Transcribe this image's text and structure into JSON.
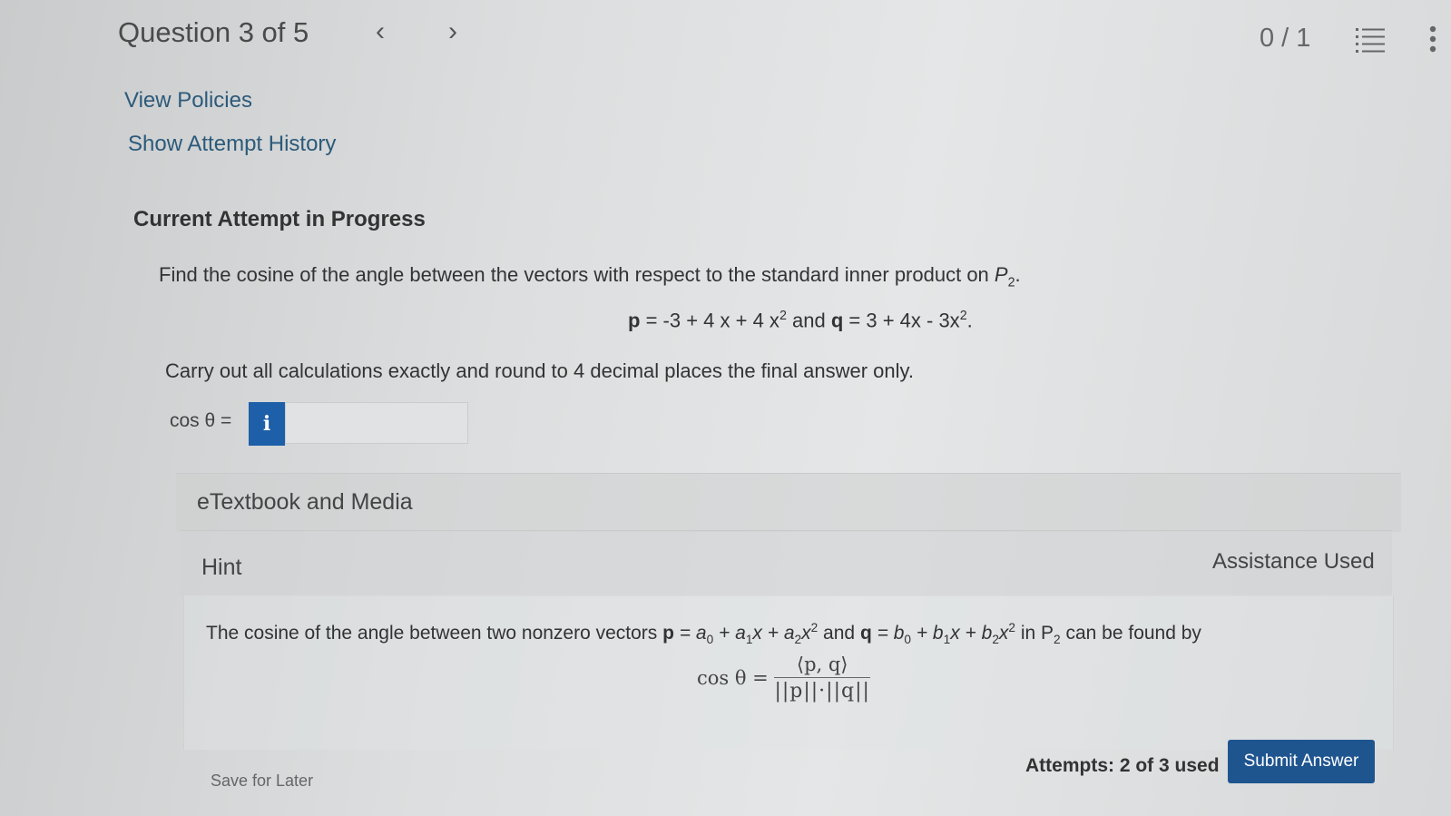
{
  "header": {
    "question_label": "Question 3 of 5",
    "prev_symbol": "‹",
    "next_symbol": "›",
    "score": "0 / 1"
  },
  "links": {
    "view_policies": "View Policies",
    "show_history": "Show Attempt History"
  },
  "attempt": {
    "section_title": "Current Attempt in Progress"
  },
  "question": {
    "prompt_prefix": "Find the cosine of the angle between the vectors with respect to the standard inner product on ",
    "space_symbol": "P",
    "space_sub": "2",
    "p_label": "p",
    "p_expr_a": " = -3 + 4 x + 4 x",
    "p_exp": "2",
    "and_word": " and ",
    "q_label": "q",
    "q_expr_a": " = 3 + 4x - 3x",
    "q_exp": "2",
    "end_period": ".",
    "instruction": "Carry out all calculations exactly and round to 4 decimal places the final answer only."
  },
  "answer": {
    "label": "cos θ =",
    "info_glyph": "i",
    "value": ""
  },
  "accordion": {
    "etextbook": "eTextbook and Media",
    "hint": "Hint",
    "assistance": "Assistance Used"
  },
  "hint": {
    "text_a": "The cosine of the angle between two nonzero vectors ",
    "p": "p",
    "p_eq": " = a",
    "s0": "0",
    "plus_a1": " + a",
    "s1": "1",
    "x_plus_a2": "x + a",
    "s2": "2",
    "x": "x",
    "sup2": "2",
    "and_q": " and ",
    "q": "q",
    "q_eq": " = b",
    "t0": "0",
    "plus_b1": " + b",
    "t1": "1",
    "x_plus_b2": "x + b",
    "t2": "2",
    "x2": "x",
    "tsup2": "2",
    "in_text": " in P",
    "psub": "2",
    "tail": " can be found by",
    "formula_lhs": "cos θ = ",
    "formula_num": "⟨p, q⟩",
    "formula_den": "||p||·||q||"
  },
  "footer": {
    "save_later": "Save for Later",
    "attempts": "Attempts: 2 of 3 used",
    "submit": "Submit Answer"
  }
}
